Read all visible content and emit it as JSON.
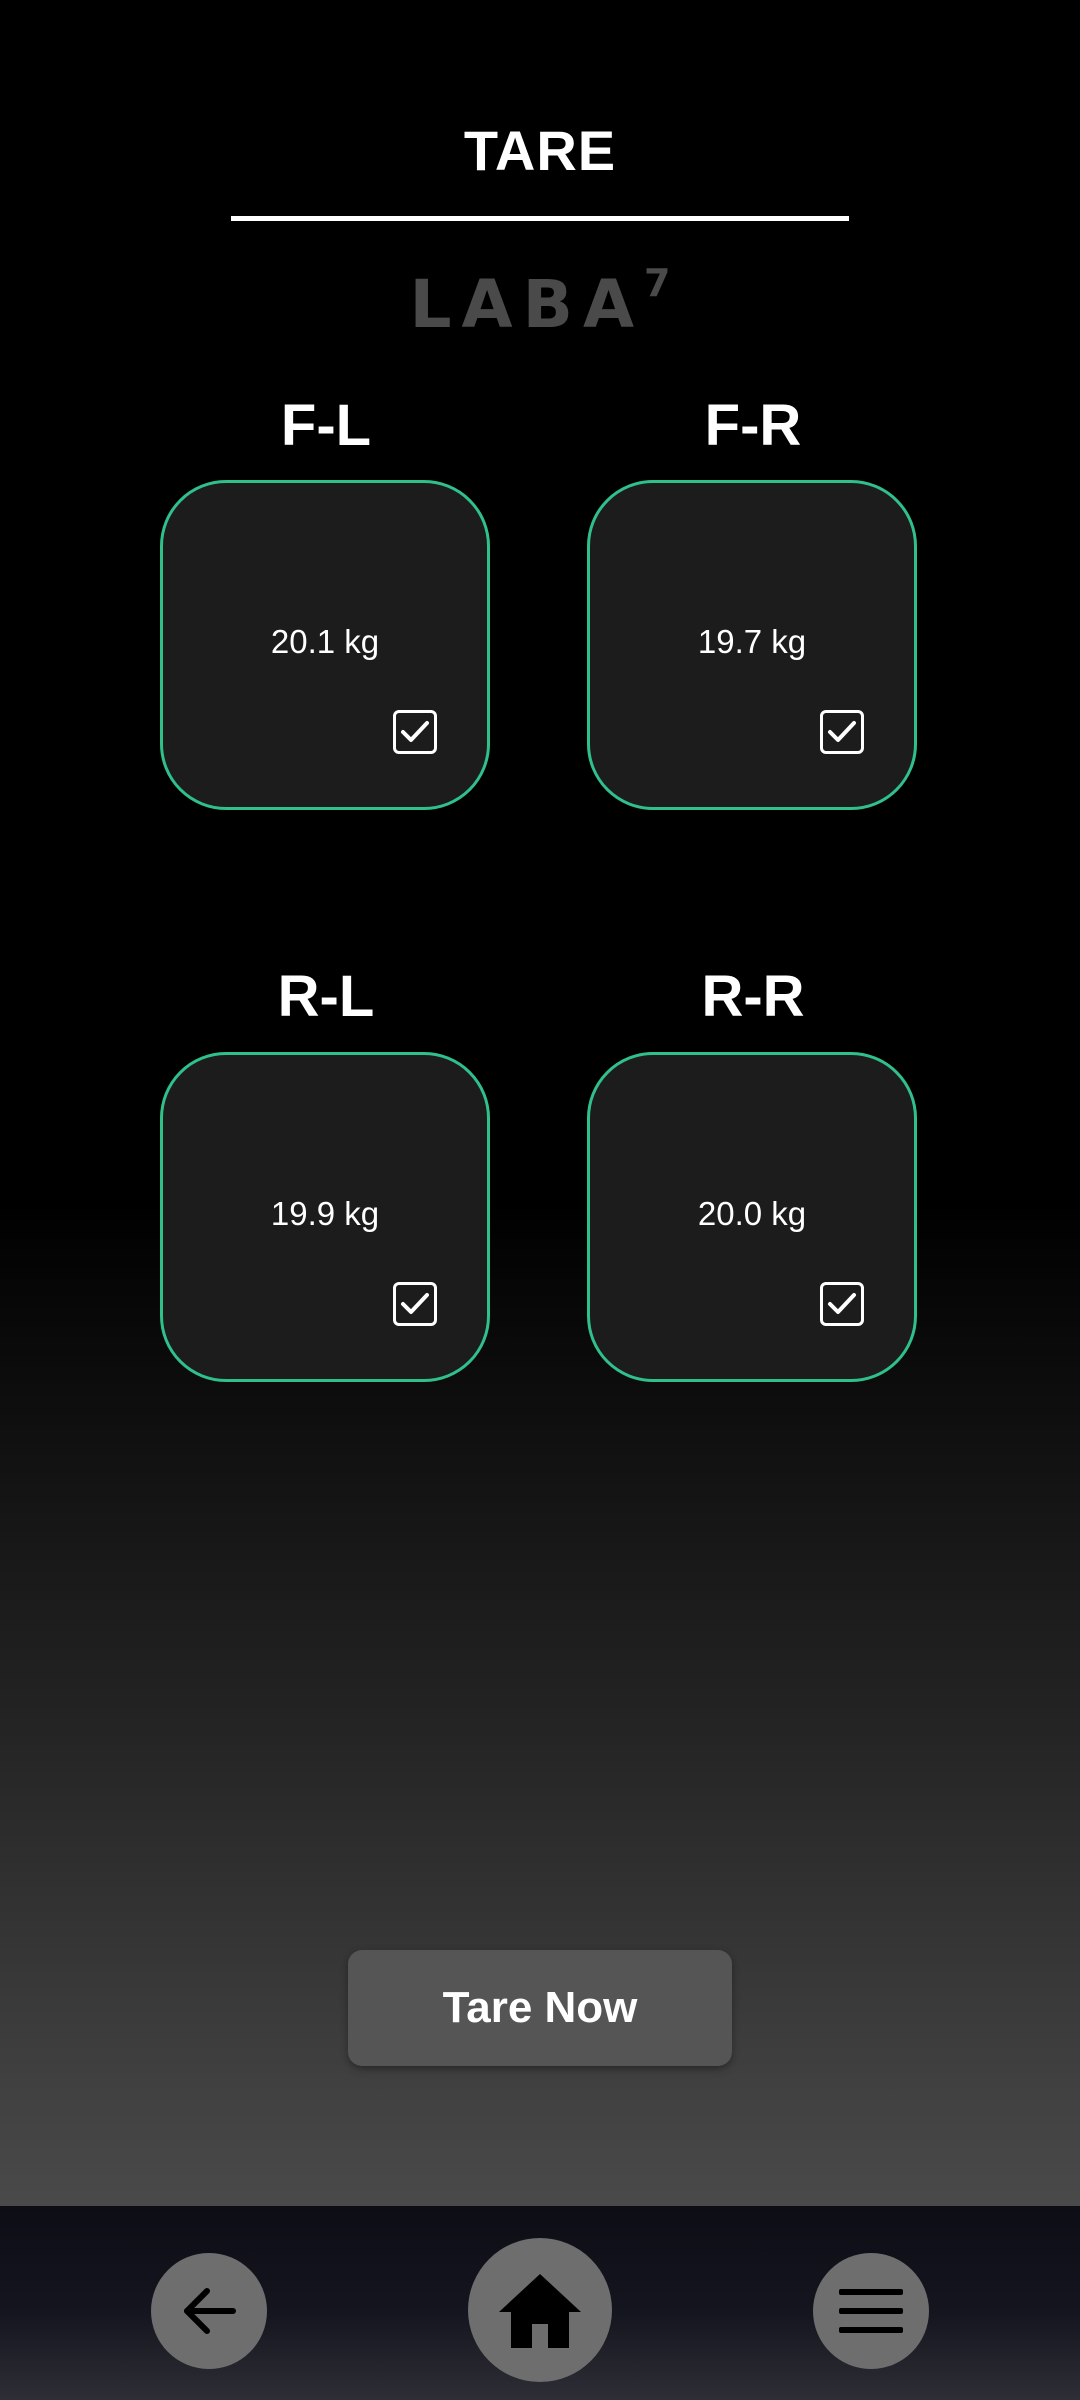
{
  "header": {
    "title": "TARE",
    "logo_text": "LABA",
    "logo_superscript": "7"
  },
  "sensors": [
    {
      "label": "F-L",
      "value": "20.1 kg",
      "checked": true
    },
    {
      "label": "F-R",
      "value": "19.7 kg",
      "checked": true
    },
    {
      "label": "R-L",
      "value": "19.9 kg",
      "checked": true
    },
    {
      "label": "R-R",
      "value": "20.0 kg",
      "checked": true
    }
  ],
  "actions": {
    "tare_label": "Tare Now"
  },
  "nav": {
    "back_icon": "arrow-left-icon",
    "home_icon": "home-icon",
    "menu_icon": "hamburger-menu-icon"
  },
  "colors": {
    "accent": "#2fc08c",
    "card_background": "#1c1c1c",
    "button": "#555555",
    "nav_button": "#6e6e6e"
  }
}
